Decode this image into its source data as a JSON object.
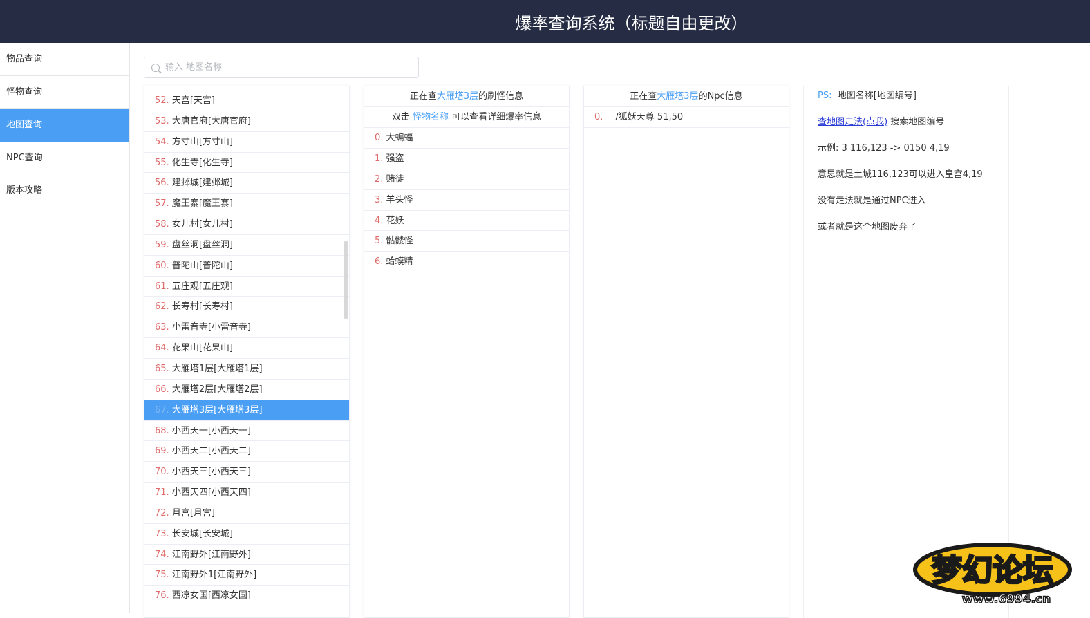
{
  "header": {
    "title": "爆率查询系统（标题自由更改）"
  },
  "sidebar": {
    "items": [
      {
        "label": "物品查询",
        "active": false
      },
      {
        "label": "怪物查询",
        "active": false
      },
      {
        "label": "地图查询",
        "active": true
      },
      {
        "label": "NPC查询",
        "active": false
      },
      {
        "label": "版本攻略",
        "active": false
      }
    ]
  },
  "search": {
    "placeholder": "输入 地图名称",
    "value": ""
  },
  "maps": [
    {
      "num": "52.",
      "name": "天宫[天宫]"
    },
    {
      "num": "53.",
      "name": "大唐官府[大唐官府]"
    },
    {
      "num": "54.",
      "name": "方寸山[方寸山]"
    },
    {
      "num": "55.",
      "name": "化生寺[化生寺]"
    },
    {
      "num": "56.",
      "name": "建邺城[建邺城]"
    },
    {
      "num": "57.",
      "name": "魔王寨[魔王寨]"
    },
    {
      "num": "58.",
      "name": "女儿村[女儿村]"
    },
    {
      "num": "59.",
      "name": "盘丝洞[盘丝洞]"
    },
    {
      "num": "60.",
      "name": "普陀山[普陀山]"
    },
    {
      "num": "61.",
      "name": "五庄观[五庄观]"
    },
    {
      "num": "62.",
      "name": "长寿村[长寿村]"
    },
    {
      "num": "63.",
      "name": "小雷音寺[小雷音寺]"
    },
    {
      "num": "64.",
      "name": "花果山[花果山]"
    },
    {
      "num": "65.",
      "name": "大雁塔1层[大雁塔1层]"
    },
    {
      "num": "66.",
      "name": "大雁塔2层[大雁塔2层]"
    },
    {
      "num": "67.",
      "name": "大雁塔3层[大雁塔3层]"
    },
    {
      "num": "68.",
      "name": "小西天一[小西天一]"
    },
    {
      "num": "69.",
      "name": "小西天二[小西天二]"
    },
    {
      "num": "70.",
      "name": "小西天三[小西天三]"
    },
    {
      "num": "71.",
      "name": "小西天四[小西天四]"
    },
    {
      "num": "72.",
      "name": "月宫[月宫]"
    },
    {
      "num": "73.",
      "name": "长安城[长安城]"
    },
    {
      "num": "74.",
      "name": "江南野外[江南野外]"
    },
    {
      "num": "75.",
      "name": "江南野外1[江南野外]"
    },
    {
      "num": "76.",
      "name": "西凉女国[西凉女国]"
    }
  ],
  "selected_map_index": 15,
  "monster_panel": {
    "prefix": "正在查",
    "map": "大雁塔3层",
    "suffix": "的刷怪信息",
    "hint_prefix": "双击",
    "hint_link": "怪物名称",
    "hint_suffix": "可以查看详细爆率信息",
    "monsters": [
      {
        "num": "0.",
        "name": "大蝙蝠"
      },
      {
        "num": "1.",
        "name": "强盗"
      },
      {
        "num": "2.",
        "name": "赌徒"
      },
      {
        "num": "3.",
        "name": "羊头怪"
      },
      {
        "num": "4.",
        "name": "花妖"
      },
      {
        "num": "5.",
        "name": "骷髅怪"
      },
      {
        "num": "6.",
        "name": "蛤蟆精"
      }
    ]
  },
  "npc_panel": {
    "prefix": "正在查",
    "map": "大雁塔3层",
    "suffix": "的Npc信息",
    "npcs": [
      {
        "num": "0.",
        "text": "/狐妖天尊 51,50"
      }
    ]
  },
  "info_panel": {
    "ps_label": "PS:",
    "ps_text": "地图名称[地图编号]",
    "link_text": "查地图走法(点我)",
    "link_suffix": "搜索地图编号",
    "example": "示例:  3 116,123 -> 0150 4,19",
    "line_meaning": "意思就是土城116,123可以进入皇宫4,19",
    "line_no_route": "没有走法就是通过NPC进入",
    "line_abandoned": "或者就是这个地图废弃了"
  },
  "watermark": {
    "text": "梦幻论坛",
    "url": "www.6994.cn"
  },
  "colors": {
    "header_bg": "#252c44",
    "accent": "#4a9ff5",
    "index_red": "#e06b6b",
    "link": "#2a3cd6"
  }
}
